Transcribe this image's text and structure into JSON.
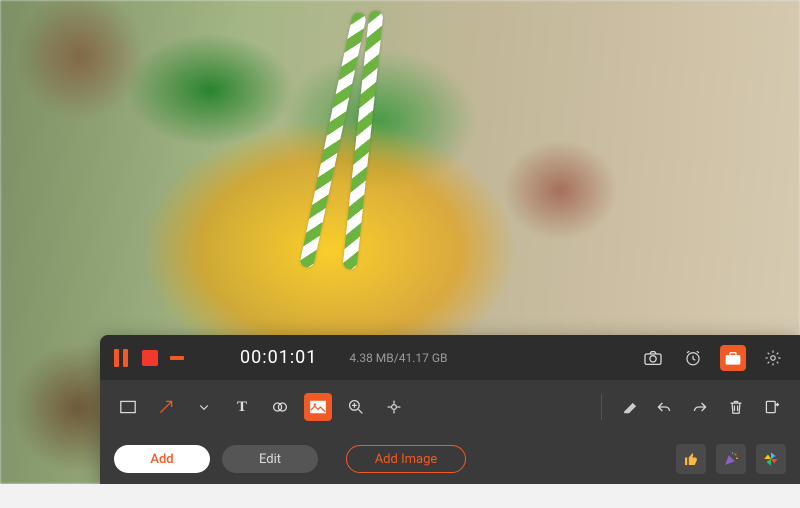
{
  "recorder": {
    "timer": "00:01:01",
    "storage": "4.38 MB/41.17 GB"
  },
  "toolbar_mid": {
    "text_tool_glyph": "T"
  },
  "tabs": {
    "add": "Add",
    "edit": "Edit",
    "add_image": "Add Image"
  }
}
